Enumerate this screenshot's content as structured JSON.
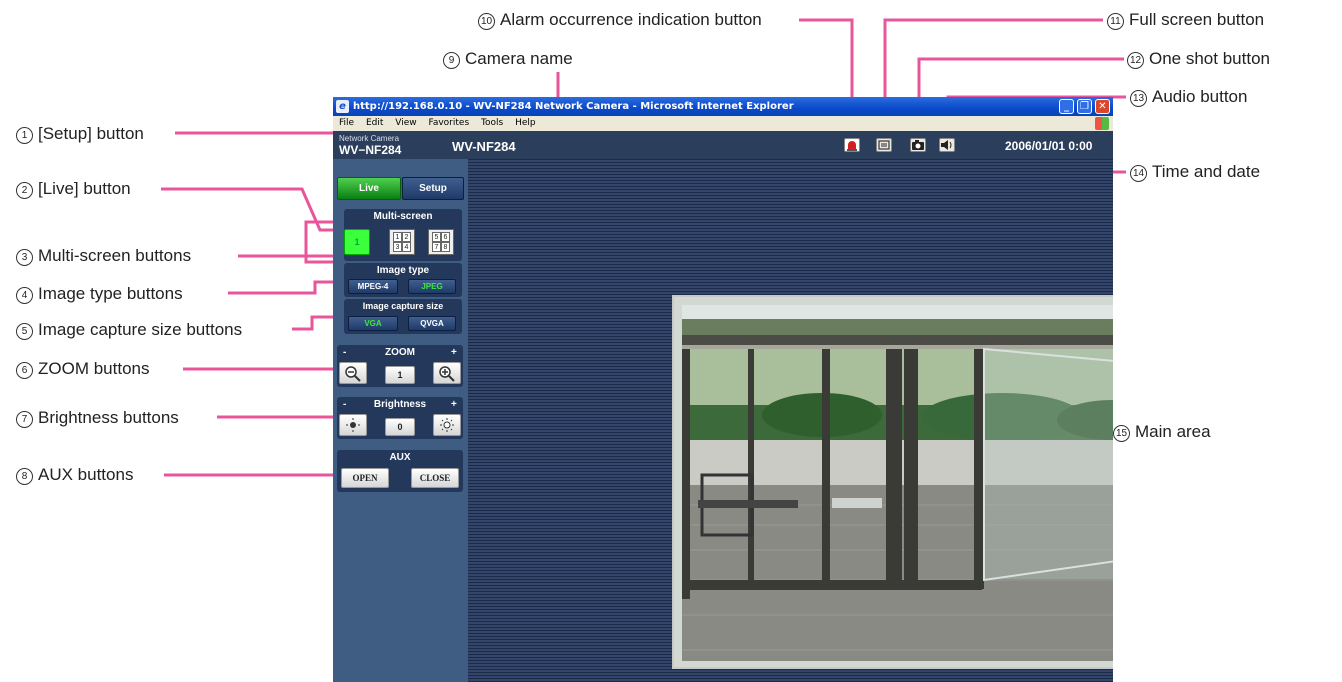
{
  "window": {
    "title": "http://192.168.0.10 - WV-NF284 Network Camera - Microsoft Internet Explorer",
    "menu": [
      "File",
      "Edit",
      "View",
      "Favorites",
      "Tools",
      "Help"
    ],
    "controls": {
      "minimize": "_",
      "restore": "❐",
      "close": "✕"
    }
  },
  "header": {
    "product_small": "Network Camera",
    "product_model": "WV−NF284",
    "camera_name": "WV-NF284",
    "datetime": "2006/01/01  0:00"
  },
  "sidebar": {
    "live_label": "Live",
    "setup_label": "Setup",
    "multiscreen": {
      "title": "Multi-screen",
      "single": "1",
      "quad_a": [
        "1",
        "2",
        "3",
        "4"
      ],
      "quad_b": [
        "5",
        "6",
        "7",
        "8"
      ]
    },
    "image_type": {
      "title": "Image type",
      "mpeg4": "MPEG-4",
      "jpeg": "JPEG"
    },
    "capture_size": {
      "title": "Image capture size",
      "vga": "VGA",
      "qvga": "QVGA"
    },
    "zoom": {
      "title": "ZOOM",
      "minus": "-",
      "plus": "+",
      "value": "1"
    },
    "brightness": {
      "title": "Brightness",
      "minus": "-",
      "plus": "+",
      "value": "0"
    },
    "aux": {
      "title": "AUX",
      "open": "OPEN",
      "close": "CLOSE"
    }
  },
  "callouts": {
    "c1": {
      "num": "1",
      "text": "[Setup] button"
    },
    "c2": {
      "num": "2",
      "text": "[Live] button"
    },
    "c3": {
      "num": "3",
      "text": "Multi-screen buttons"
    },
    "c4": {
      "num": "4",
      "text": "Image type buttons"
    },
    "c5": {
      "num": "5",
      "text": "Image capture size buttons"
    },
    "c6": {
      "num": "6",
      "text": "ZOOM buttons"
    },
    "c7": {
      "num": "7",
      "text": "Brightness buttons"
    },
    "c8": {
      "num": "8",
      "text": "AUX buttons"
    },
    "c9": {
      "num": "9",
      "text": "Camera name"
    },
    "c10": {
      "num": "10",
      "text": "Alarm occurrence indication button"
    },
    "c11": {
      "num": "11",
      "text": "Full screen button"
    },
    "c12": {
      "num": "12",
      "text": "One shot button"
    },
    "c13": {
      "num": "13",
      "text": "Audio button"
    },
    "c14": {
      "num": "14",
      "text": "Time and date"
    },
    "c15": {
      "num": "15",
      "text": "Main area"
    }
  },
  "colors": {
    "callout_line": "#e8559a",
    "live_green": "#0a7e12",
    "sidebar_bg": "#3f5c83"
  }
}
